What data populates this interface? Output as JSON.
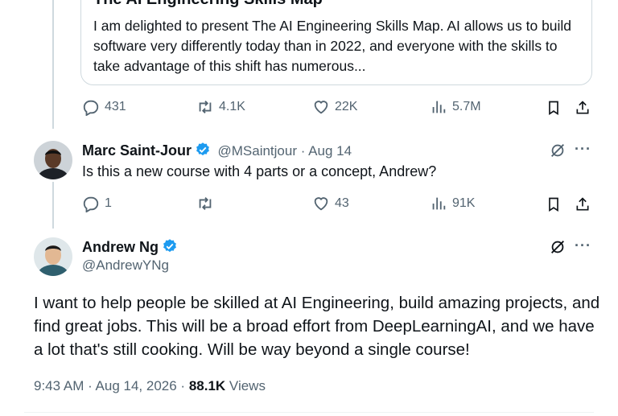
{
  "quoted_card": {
    "title": "The AI Engineering Skills Map",
    "text": "I am delighted to present The AI Engineering Skills Map. AI allows us to build software very differently today than in 2022, and everyone with the skills to take advantage of this shift has numerous..."
  },
  "first_actions": {
    "replies": "431",
    "reposts": "4.1K",
    "likes": "22K",
    "views": "5.7M"
  },
  "reply": {
    "name": "Marc Saint-Jour",
    "handle_date": "@MSaintjour · Aug 14",
    "text": "Is this a new course with 4 parts or a concept, Andrew?",
    "replies": "1",
    "reposts": "",
    "likes": "43",
    "views": "91K"
  },
  "main": {
    "name": "Andrew Ng",
    "handle": "@AndrewYNg",
    "text": "I want to help people be skilled at AI Engineering, build amazing projects, and find great jobs. This will be a broad effort from DeepLearningAI, and we have a lot that's still cooking. Will be way beyond a single course!",
    "time": "9:43 AM · Aug 14, 2026 ·",
    "views_count": "88.1K",
    "views_label": "Views"
  },
  "colors": {
    "accent": "#1d9bf0",
    "muted": "#536471",
    "border": "#cfd9de"
  },
  "icons": [
    "reply-icon",
    "repost-icon",
    "like-icon",
    "views-icon",
    "bookmark-icon",
    "share-icon",
    "grok-icon",
    "more-icon",
    "verified-icon"
  ]
}
